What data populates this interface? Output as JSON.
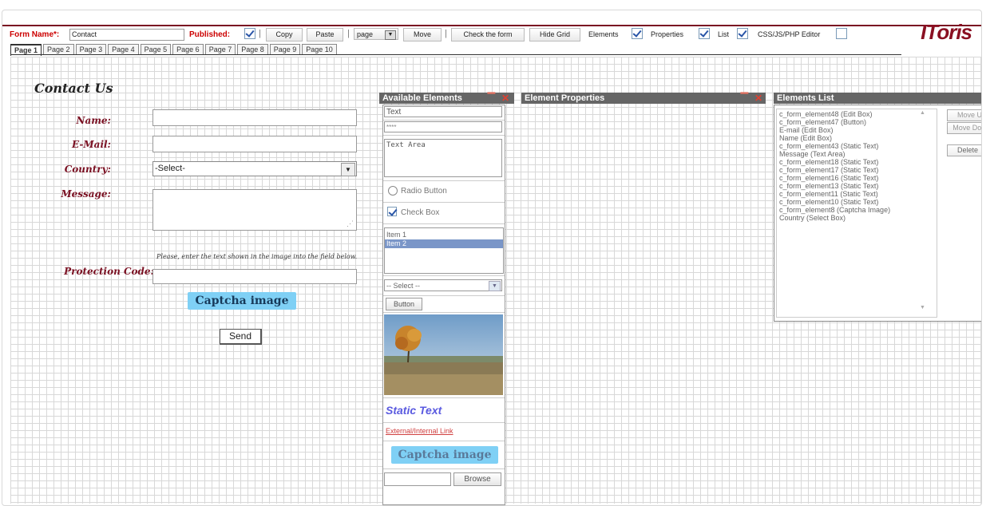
{
  "toolbar": {
    "form_name_label": "Form Name*:",
    "form_name_value": "Contact",
    "published_label": "Published:",
    "copy": "Copy",
    "paste": "Paste",
    "page_select": "page",
    "move": "Move",
    "check_form": "Check the form",
    "hide_grid": "Hide Grid",
    "elements": "Elements",
    "properties": "Properties",
    "list": "List",
    "css_editor": "CSS/JS/PHP Editor",
    "logo": "IToris"
  },
  "tabs": [
    "Page 1",
    "Page 2",
    "Page 3",
    "Page 4",
    "Page 5",
    "Page 6",
    "Page 7",
    "Page 8",
    "Page 9",
    "Page 10"
  ],
  "form": {
    "title": "Contact Us",
    "name_label": "Name:",
    "email_label": "E-Mail:",
    "country_label": "Country:",
    "country_value": "-Select-",
    "message_label": "Message:",
    "captcha_hint": "Please, enter the text shown in the image into the field below.",
    "protection_label": "Protection Code:",
    "captcha_image": "Captcha image",
    "send": "Send"
  },
  "available_elements": {
    "title": "Available Elements",
    "text": "Text",
    "password": "****",
    "text_area": "Text Area",
    "radio": "Radio Button",
    "checkbox": "Check Box",
    "list_items": [
      "Item 1",
      "Item 2"
    ],
    "select": "-- Select --",
    "button": "Button",
    "static_text": "Static Text",
    "link": "External/Internal Link",
    "captcha": "Captcha image",
    "browse": "Browse"
  },
  "element_properties": {
    "title": "Element Properties"
  },
  "elements_list": {
    "title": "Elements List",
    "items": [
      "c_form_element48 (Edit Box)",
      "c_form_element47 (Button)",
      "E-mail (Edit Box)",
      "Name (Edit Box)",
      "c_form_element43 (Static Text)",
      "Message (Text Area)",
      "c_form_element18 (Static Text)",
      "c_form_element17 (Static Text)",
      "c_form_element16 (Static Text)",
      "c_form_element13 (Static Text)",
      "c_form_element11 (Static Text)",
      "c_form_element10 (Static Text)",
      "c_form_element8 (Captcha Image)",
      "Country (Select Box)"
    ],
    "move_up": "Move Up",
    "move_down": "Move Down",
    "delete": "Delete"
  },
  "colors": {
    "accent": "#7a1022",
    "panel_header": "#666666",
    "captcha": "#7fd0f5"
  }
}
